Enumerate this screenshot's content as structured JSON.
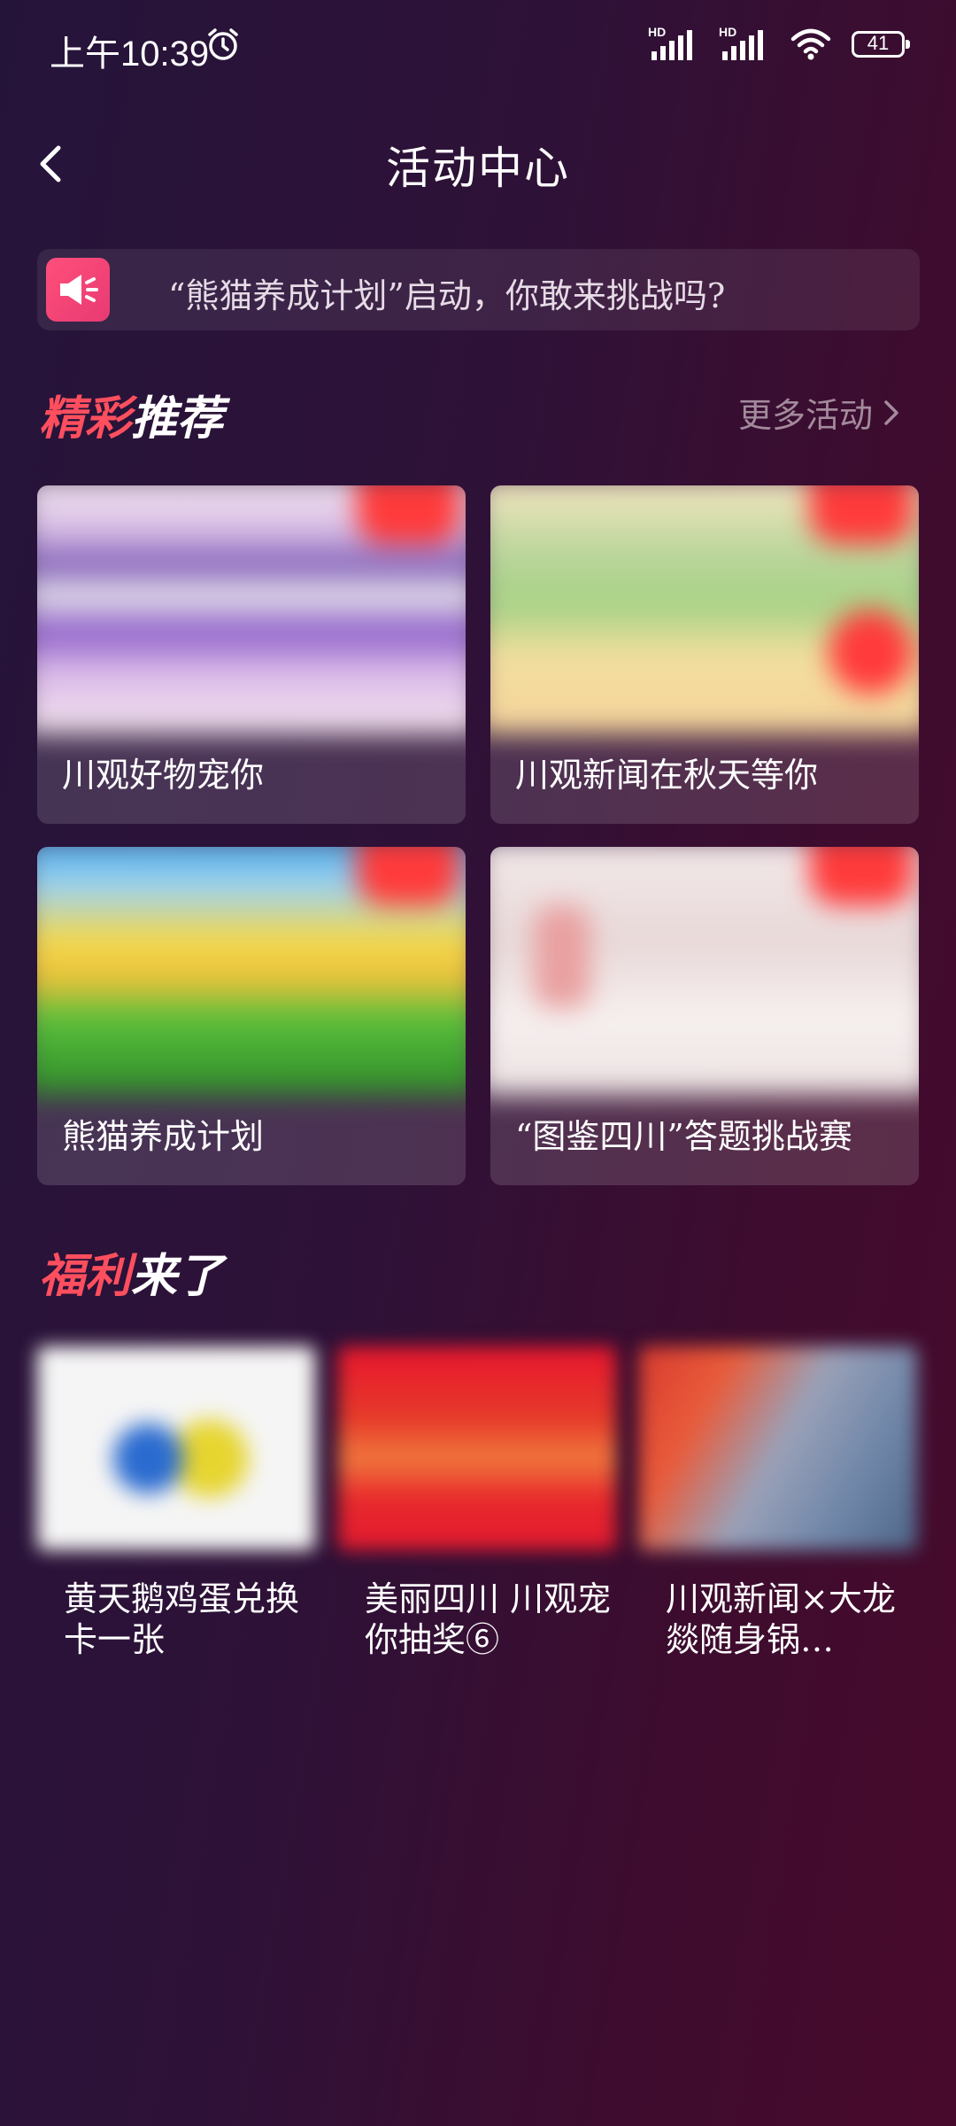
{
  "status_bar": {
    "time": "上午10:39",
    "signal1_label": "HD",
    "signal2_label": "HD",
    "battery": "41"
  },
  "nav": {
    "title": "活动中心"
  },
  "notice": {
    "text": "“熊猫养成计划”启动，你敢来挑战吗?"
  },
  "recommend": {
    "title_part1": "精彩",
    "title_part2": "推荐",
    "more_label": "更多活动",
    "cards": [
      {
        "label": "川观好物宠你"
      },
      {
        "label": "川观新闻在秋天等你"
      },
      {
        "label": "熊猫养成计划"
      },
      {
        "label": "“图鉴四川”答题挑战赛"
      }
    ]
  },
  "welfare": {
    "title_part1": "福利",
    "title_part2": "来了",
    "items": [
      {
        "label": "黄天鹅鸡蛋兑换卡一张"
      },
      {
        "label": "美丽四川 川观宠你抽奖⑥"
      },
      {
        "label": "川观新闻×大龙燚随身锅…"
      }
    ]
  },
  "colors": {
    "accent_red": "#ff4f5e",
    "notice_icon": "#e83a73",
    "background_left": "#25143a",
    "background_right": "#480a2c"
  }
}
